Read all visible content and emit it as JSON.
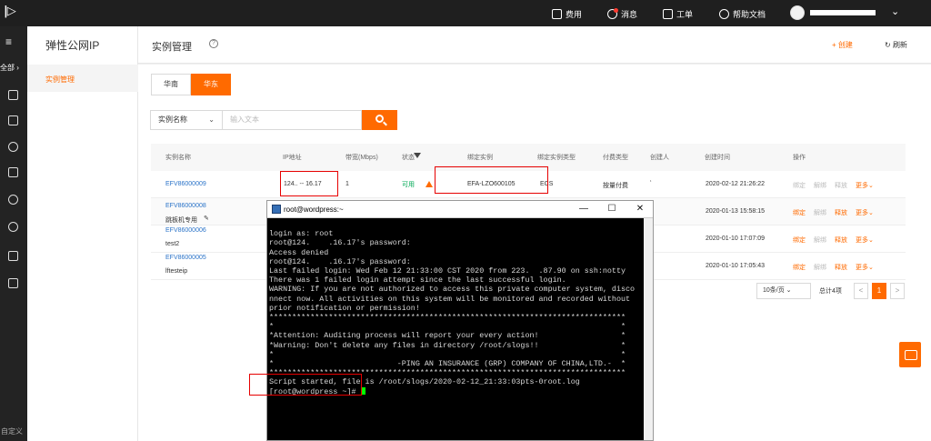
{
  "topbar": {
    "items": [
      {
        "label": "费用",
        "icon": "billing-icon"
      },
      {
        "label": "消息",
        "icon": "message-icon"
      },
      {
        "label": "工单",
        "icon": "ticket-icon"
      },
      {
        "label": "帮助文档",
        "icon": "help-icon"
      }
    ]
  },
  "leftrail": {
    "all_label": "全部",
    "custom_label": "自定义"
  },
  "sidebar": {
    "title": "弹性公网IP",
    "active_item": "实例管理"
  },
  "header": {
    "title": "实例管理",
    "create": "+ 创建",
    "refresh": "刷新"
  },
  "regions": [
    "华南",
    "华东"
  ],
  "search": {
    "field": "实例名称",
    "placeholder": "输入文本"
  },
  "table": {
    "columns": [
      "实例名称",
      "IP地址",
      "带宽(Mbps)",
      "状态",
      "绑定实例",
      "绑定实例类型",
      "付费类型",
      "创建人",
      "创建时间",
      "操作"
    ],
    "rows": [
      {
        "name": "EFV86000009",
        "ip": "124.. -- 16.17",
        "bandwidth": "1",
        "status": "可用",
        "bind": "EFA-LZO600105",
        "bind_type": "ECS",
        "pay": "按量付费",
        "creator": "‘",
        "created": "2020-02-12 21:26:22",
        "desc": ""
      },
      {
        "name": "EFV86000008",
        "ip": "",
        "bandwidth": "",
        "status": "",
        "bind": "",
        "bind_type": "",
        "pay": "",
        "creator": "",
        "created": "2020-01-13 15:58:15",
        "desc": "跳板机专用"
      },
      {
        "name": "EFV86000006",
        "ip": "",
        "bandwidth": "",
        "status": "",
        "bind": "",
        "bind_type": "",
        "pay": "",
        "creator": "",
        "created": "2020-01-10 17:07:09",
        "desc": "test2"
      },
      {
        "name": "EFV86000005",
        "ip": "",
        "bandwidth": "",
        "status": "",
        "bind": "",
        "bind_type": "",
        "pay": "",
        "creator": "f",
        "created": "2020-01-10 17:05:43",
        "desc": "lftesteip"
      }
    ],
    "actions": [
      "绑定",
      "解绑",
      "释放",
      "更多"
    ]
  },
  "pager": {
    "size": "10条/页",
    "total": "总计4项",
    "page": "1",
    "prev": "<",
    "next": ">"
  },
  "terminal": {
    "title": "root@wordpress:~",
    "min": "—",
    "max": "☐",
    "close": "✕",
    "lines": [
      "login as: root",
      "root@124.    .16.17's password:",
      "Access denied",
      "root@124.    .16.17's password:",
      "Last failed login: Wed Feb 12 21:33:00 CST 2020 from 223.  .87.90 on ssh:notty",
      "There was 1 failed login attempt since the last successful login.",
      "WARNING: If you are not authorized to access this private computer system, disco",
      "nnect now. All activities on this system will be monitored and recorded without",
      "prior notification or permission!",
      "******************************************************************************",
      "*                                                                            *",
      "*Attention: Auditing process will report your every action!                  *",
      "*Warning: Don't delete any files in directory /root/slogs!!                  *",
      "*                                                                            *",
      "*                           -PING AN INSURANCE (GRP) COMPANY OF CHINA,LTD.-  *",
      "******************************************************************************",
      "Script started, file is /root/slogs/2020-02-12_21:33:03pts-0root.log"
    ],
    "prompt": "[root@wordpress ~]# "
  },
  "colors": {
    "accent": "#ff6a00",
    "link": "#2a73c8",
    "status_ok": "#00a854",
    "highlight": "#e60000"
  }
}
